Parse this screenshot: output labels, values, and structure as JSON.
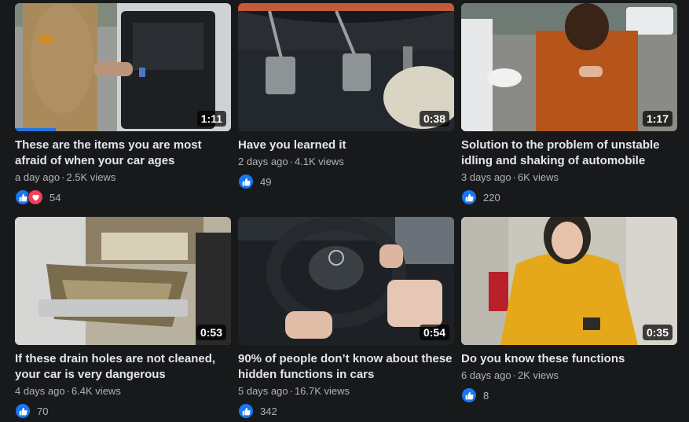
{
  "videos": [
    {
      "title": "These are the items you are most afraid of when your car ages",
      "age": "a day ago",
      "views": "2.5K views",
      "reactions": "54",
      "duration": "1:11",
      "reaction_types": [
        "like-icon",
        "love-icon"
      ],
      "watched_fraction": 0.19
    },
    {
      "title": "Have you learned it",
      "age": "2 days ago",
      "views": "4.1K views",
      "reactions": "49",
      "duration": "0:38",
      "reaction_types": [
        "like-icon"
      ]
    },
    {
      "title": "Solution to the problem of unstable idling and shaking of automobile",
      "age": "3 days ago",
      "views": "6K views",
      "reactions": "220",
      "duration": "1:17",
      "reaction_types": [
        "like-icon"
      ]
    },
    {
      "title": "If these drain holes are not cleaned, your car is very dangerous",
      "age": "4 days ago",
      "views": "6.4K views",
      "reactions": "70",
      "duration": "0:53",
      "reaction_types": [
        "like-icon"
      ]
    },
    {
      "title": "90% of people don’t know about these hidden functions in cars",
      "age": "5 days ago",
      "views": "16.7K views",
      "reactions": "342",
      "duration": "0:54",
      "reaction_types": [
        "like-icon"
      ]
    },
    {
      "title": "Do you know these functions",
      "age": "6 days ago",
      "views": "2K views",
      "reactions": "8",
      "duration": "0:35",
      "reaction_types": [
        "like-icon"
      ]
    }
  ],
  "colors": {
    "background": "#18191a",
    "accent": "#2374e1",
    "like": "#1877f2",
    "love": "#f33e58"
  }
}
